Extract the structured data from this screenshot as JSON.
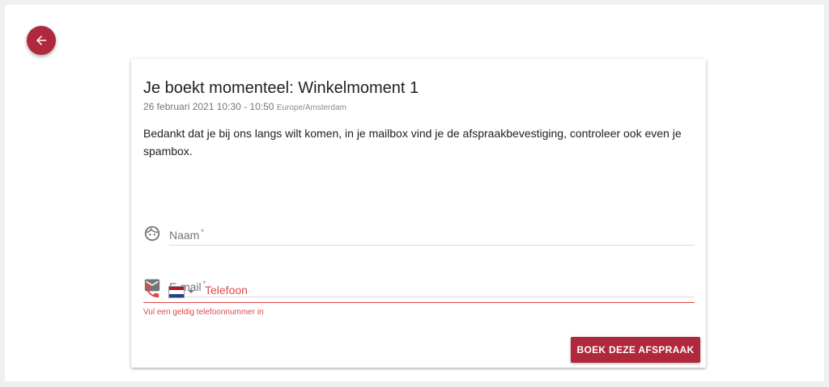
{
  "colors": {
    "accent": "#b0283b",
    "error": "#e04848",
    "text": "#212121",
    "muted": "#757575"
  },
  "back_button": {
    "icon": "arrow-left-icon"
  },
  "booking": {
    "title": "Je boekt momenteel: Winkelmoment 1",
    "datetime": "26 februari 2021 10:30 - 10:50",
    "timezone": "Europe/Amsterdam",
    "description": "Bedankt dat je bij ons langs wilt komen, in je mailbox vind je de afspraakbevestiging, controleer ook even je spambox."
  },
  "form": {
    "name": {
      "label": "Naam",
      "required_mark": "*",
      "icon": "face-icon"
    },
    "email": {
      "label": "E-mail",
      "required_mark": "*",
      "icon": "mail-icon"
    },
    "phone": {
      "placeholder": "Telefoon",
      "value": "",
      "icon": "phone-icon",
      "country_flag": "netherlands-flag-icon",
      "error": "Vul een geldig telefoonnummer in"
    },
    "submit_label": "BOEK DEZE AFSPRAAK"
  }
}
